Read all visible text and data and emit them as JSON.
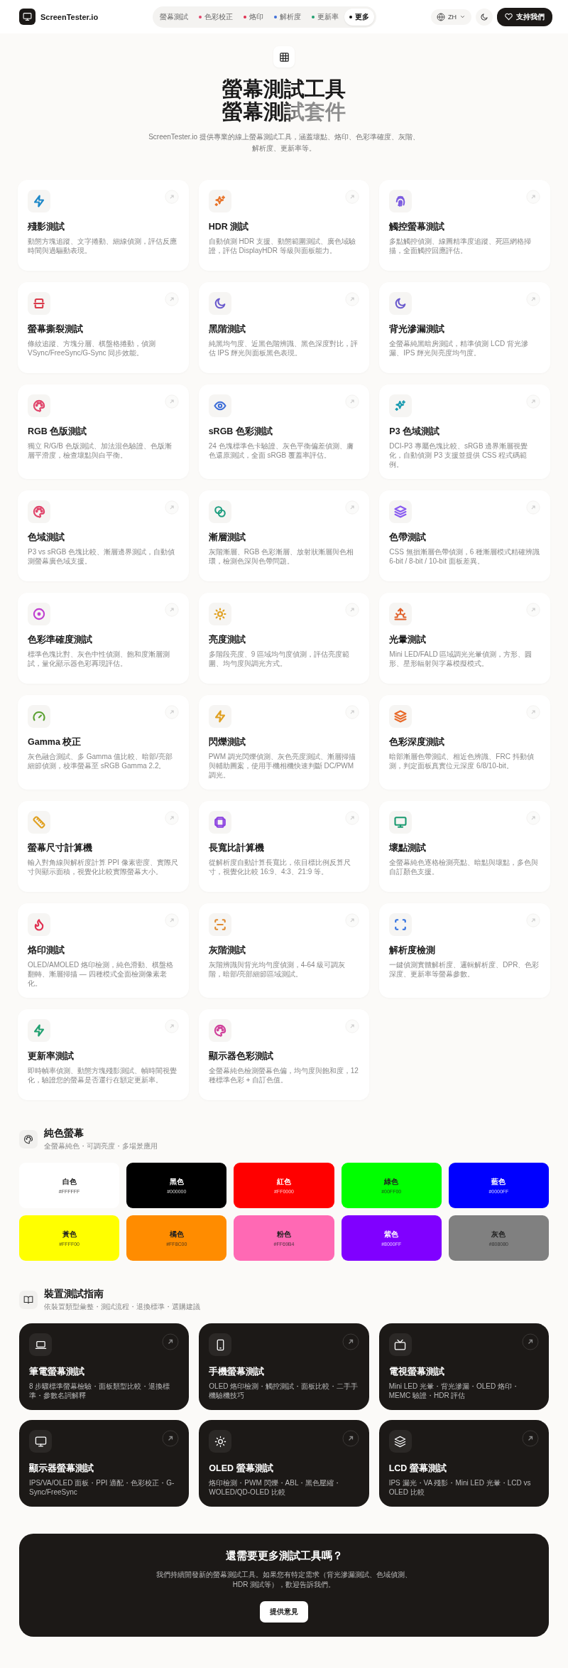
{
  "header": {
    "logo": "ScreenTester.io",
    "language": "ZH",
    "support_button": "支持我們",
    "nav": [
      {
        "label": "螢幕測試",
        "selected": false
      },
      {
        "label": "色彩校正",
        "selected": false,
        "color": "#e0446a"
      },
      {
        "label": "烙印",
        "selected": false,
        "color": "#e03050"
      },
      {
        "label": "解析度",
        "selected": false,
        "color": "#3f6fd8"
      },
      {
        "label": "更新率",
        "selected": false,
        "color": "#20a070"
      },
      {
        "label": "更多",
        "selected": true,
        "color": "#111111"
      }
    ]
  },
  "hero": {
    "title": "螢幕測試工具",
    "title_line2": "螢幕測試套件",
    "description": "ScreenTester.io 提供專業的線上螢幕測試工具，涵蓋壞點、烙印、色彩準確度、灰階、解析度、更新率等。"
  },
  "tools": [
    {
      "title": "殘影測試",
      "description": "動態方塊追蹤、文字捲動、細線偵測，評估反應時間與過驅動表現。",
      "kind": "bolt",
      "color": "#1e88c8"
    },
    {
      "title": "HDR 測試",
      "description": "自動偵測 HDR 支援、動態範圍測試、廣色域驗證，評估 DisplayHDR 等級與面板能力。",
      "kind": "sparkles",
      "color": "#e8742a"
    },
    {
      "title": "觸控螢幕測試",
      "description": "多點觸控偵測、線圖精準度追蹤、死區網格掃描，全面觸控回應評估。",
      "kind": "fingerprint",
      "color": "#7c5ce0"
    },
    {
      "title": "螢幕撕裂測試",
      "description": "條紋追蹤、方塊分層、棋盤格捲動，偵測 VSync/FreeSync/G-Sync 同步效能。",
      "kind": "split",
      "color": "#d93a4a"
    },
    {
      "title": "黑階測試",
      "description": "純黑均勻度、近黑色階辨識、黑色深度對比，評估 IPS 輝光與面板黑色表現。",
      "kind": "moon",
      "color": "#6a5acd"
    },
    {
      "title": "背光滲漏測試",
      "description": "全螢幕純黑暗房測試，精準偵測 LCD 背光滲漏、IPS 輝光與亮度均勻度。",
      "kind": "moon",
      "color": "#6a5acd"
    },
    {
      "title": "RGB 色版測試",
      "description": "獨立 R/G/B 色版測試、加法混色驗證、色版漸層平滑度，檢查壞點與白平衡。",
      "kind": "palette",
      "color": "#e0446a"
    },
    {
      "title": "sRGB 色彩測試",
      "description": "24 色塊標準色卡驗證、灰色平衡偏差偵測、膚色還原測試，全面 sRGB 覆蓋率評估。",
      "kind": "eye",
      "color": "#3f6fd8"
    },
    {
      "title": "P3 色域測試",
      "description": "DCI-P3 專屬色塊比較、sRGB 邊界漸層視覺化，自動偵測 P3 支援並提供 CSS 程式碼範例。",
      "kind": "sparkles",
      "color": "#1a9bb0"
    },
    {
      "title": "色域測試",
      "description": "P3 vs sRGB 色塊比較、漸層邊界測試，自動偵測螢幕廣色域支援。",
      "kind": "palette",
      "color": "#e0446a"
    },
    {
      "title": "漸層測試",
      "description": "灰階漸層、RGB 色彩漸層、放射狀漸層與色相環，檢測色深與色帶問題。",
      "kind": "circles",
      "color": "#1f9e80"
    },
    {
      "title": "色帶測試",
      "description": "CSS 無損漸層色帶偵測，6 種漸層模式精確辨識 6-bit / 8-bit / 10-bit 面板差異。",
      "kind": "layers",
      "color": "#8a5cf0"
    },
    {
      "title": "色彩準確度測試",
      "description": "標準色塊比對、灰色中性偵測、飽和度漸層測試，量化顯示器色彩再現評估。",
      "kind": "target",
      "color": "#c040d0"
    },
    {
      "title": "亮度測試",
      "description": "多階段亮度、9 區域均勻度偵測，評估亮度範圍、均勻度與調光方式。",
      "kind": "sun",
      "color": "#e0a020"
    },
    {
      "title": "光暈測試",
      "description": "Mini LED/FALD 區域調光光暈偵測，方形、圓形、星形輻射與字幕模擬模式。",
      "kind": "sunrise",
      "color": "#e0602a"
    },
    {
      "title": "Gamma 校正",
      "description": "灰色融合測試、多 Gamma 值比較、暗部/亮部細節偵測，校準螢幕至 sRGB Gamma 2.2。",
      "kind": "gauge",
      "color": "#5aa030"
    },
    {
      "title": "閃爍測試",
      "description": "PWM 調光閃爍偵測、灰色亮度測試、漸層掃描與輔助圖案，使用手機相機快速判斷 DC/PWM 調光。",
      "kind": "bolt",
      "color": "#e0a020"
    },
    {
      "title": "色彩深度測試",
      "description": "暗部漸層色帶測試、相近色辨識、FRC 抖動偵測，判定面板真實位元深度 6/8/10-bit。",
      "kind": "layers",
      "color": "#e86a2a"
    },
    {
      "title": "螢幕尺寸計算機",
      "description": "輸入對角線與解析度計算 PPI 像素密度、實際尺寸與顯示面積，視覺化比較實際螢幕大小。",
      "kind": "ruler",
      "color": "#e0a020"
    },
    {
      "title": "長寬比計算機",
      "description": "從解析度自動計算長寬比，依目標比例反算尺寸，視覺化比較 16:9、4:3、21:9 等。",
      "kind": "frame",
      "color": "#8a40e0"
    },
    {
      "title": "壞點測試",
      "description": "全螢幕純色逐格檢測亮點、暗點與壞點，多色與自訂顏色支援。",
      "kind": "monitor",
      "color": "#1a9a70"
    },
    {
      "title": "烙印測試",
      "description": "OLED/AMOLED 烙印檢測，純色滑動、棋盤格翻轉、漸層掃描 — 四種模式全面檢測像素老化。",
      "kind": "flame",
      "color": "#e03050"
    },
    {
      "title": "灰階測試",
      "description": "灰階辨識與背光均勻度偵測，4-64 級可調灰階，暗部/亮部細節區域測試。",
      "kind": "scan",
      "color": "#e08a30"
    },
    {
      "title": "解析度檢測",
      "description": "一鍵偵測實體解析度、邏輯解析度、DPR、色彩深度、更新率等螢幕參數。",
      "kind": "focus",
      "color": "#3070e0"
    },
    {
      "title": "更新率測試",
      "description": "即時幀率偵測、動態方塊殘影測試、幀時間視覺化，驗證您的螢幕是否運行在額定更新率。",
      "kind": "bolt",
      "color": "#20a070"
    },
    {
      "title": "顯示器色彩測試",
      "description": "全螢幕純色檢測螢幕色偏，均勻度與飽和度，12 種標準色彩 + 自訂色值。",
      "kind": "palette",
      "color": "#d0409a"
    }
  ],
  "solid_colors": {
    "title": "純色螢幕",
    "subtitle": "全螢幕純色・可調亮度・多場景應用",
    "swatches": [
      {
        "name": "白色",
        "hex": "#FFFFFF",
        "color": "#ffffff"
      },
      {
        "name": "黑色",
        "hex": "#000000",
        "color": "#000000"
      },
      {
        "name": "紅色",
        "hex": "#FF0000",
        "color": "#ff0000"
      },
      {
        "name": "綠色",
        "hex": "#00FF00",
        "color": "#00ff00"
      },
      {
        "name": "藍色",
        "hex": "#0000FF",
        "color": "#0000ff"
      },
      {
        "name": "黃色",
        "hex": "#FFFF00",
        "color": "#ffff00"
      },
      {
        "name": "橘色",
        "hex": "#FF8C00",
        "color": "#ff8c00"
      },
      {
        "name": "粉色",
        "hex": "#FF69B4",
        "color": "#ff69b4"
      },
      {
        "name": "紫色",
        "hex": "#8000FF",
        "color": "#8000ff"
      },
      {
        "name": "灰色",
        "hex": "#808080",
        "color": "#808080"
      }
    ]
  },
  "device_guides": {
    "title": "裝置測試指南",
    "subtitle": "依裝置類型彙整・測試流程・退換標準・選購建議",
    "cards": [
      {
        "title": "筆電螢幕測試",
        "description": "8 步驟標準螢幕檢驗・面板類型比較・退換標準・參數名詞解釋",
        "kind": "laptop"
      },
      {
        "title": "手機螢幕測試",
        "description": "OLED 烙印檢測・觸控測試・面板比較・二手手機驗機技巧",
        "kind": "phone"
      },
      {
        "title": "電視螢幕測試",
        "description": "Mini LED 光暈・背光滲漏・OLED 烙印・MEMC 驗證・HDR 評估",
        "kind": "tv"
      },
      {
        "title": "顯示器螢幕測試",
        "description": "IPS/VA/OLED 面板・PPI 適配・色彩校正・G-Sync/FreeSync",
        "kind": "monitor"
      },
      {
        "title": "OLED 螢幕測試",
        "description": "烙印檢測・PWM 閃爍・ABL・黑色壓縮・WOLED/QD-OLED 比較",
        "kind": "sun"
      },
      {
        "title": "LCD 螢幕測試",
        "description": "IPS 漏光・VA 殘影・Mini LED 光暈・LCD vs OLED 比較",
        "kind": "layers"
      }
    ]
  },
  "cta": {
    "title": "還需要更多測試工具嗎？",
    "description": "我們持續開發新的螢幕測試工具。如果您有特定需求（背光滲漏測試、色域偵測、HDR 測試等），歡迎告訴我們。",
    "button": "提供意見"
  }
}
